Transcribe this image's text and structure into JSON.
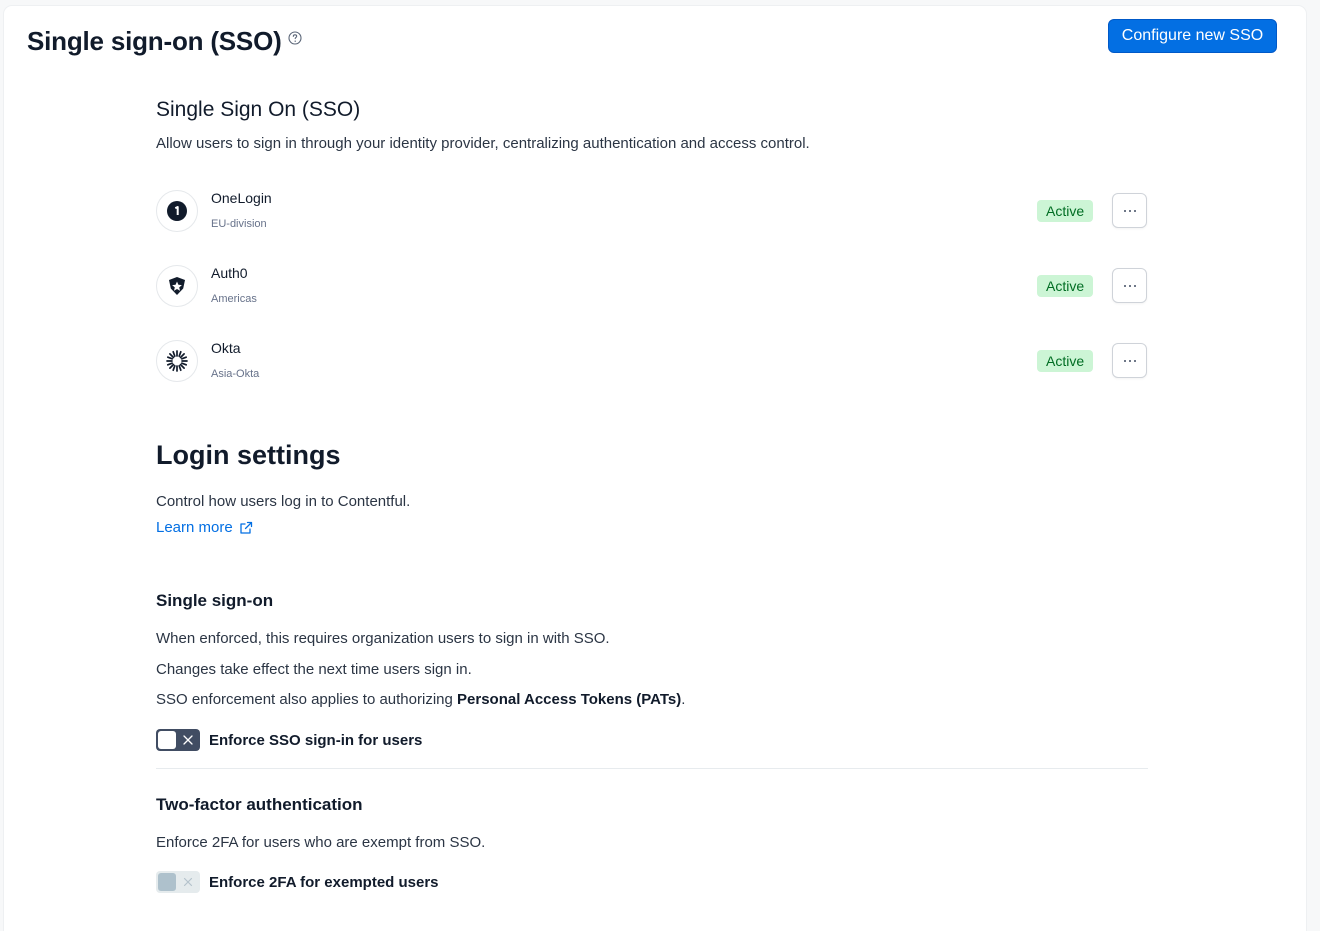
{
  "header": {
    "title": "Single sign-on (SSO)",
    "help_icon": "help-circle-icon",
    "configure_button": "Configure new SSO"
  },
  "sso_section": {
    "heading": "Single Sign On (SSO)",
    "description": "Allow users to sign in through your identity provider, centralizing authentication and access control.",
    "providers": [
      {
        "name": "OneLogin",
        "sub": "EU-division",
        "status": "Active",
        "icon": "onelogin-logo-icon"
      },
      {
        "name": "Auth0",
        "sub": "Americas",
        "status": "Active",
        "icon": "auth0-logo-icon"
      },
      {
        "name": "Okta",
        "sub": "Asia-Okta",
        "status": "Active",
        "icon": "okta-logo-icon"
      }
    ],
    "more_icon": "more-horizontal-icon"
  },
  "login_settings": {
    "heading": "Login settings",
    "description": "Control how users log in to Contentful.",
    "learn_more": "Learn more",
    "learn_more_icon": "external-link-icon"
  },
  "single_sign_on": {
    "heading": "Single sign-on",
    "line1": "When enforced, this requires organization users to sign in with SSO.",
    "line2": "Changes take effect the next time users sign in.",
    "line3_prefix": "SSO enforcement also applies to authorizing ",
    "line3_bold": "Personal Access Tokens (PATs)",
    "line3_suffix": ".",
    "toggle_label": "Enforce SSO sign-in for users",
    "toggle_on": false
  },
  "two_factor": {
    "heading": "Two-factor authentication",
    "description": "Enforce 2FA for users who are exempt from SSO.",
    "toggle_label": "Enforce 2FA for exempted users",
    "toggle_on": false,
    "toggle_disabled": true
  },
  "colors": {
    "primary": "#036fe3",
    "badge_bg": "#ccf5d5",
    "badge_text": "#006d23",
    "toggle_off": "#414d63"
  }
}
